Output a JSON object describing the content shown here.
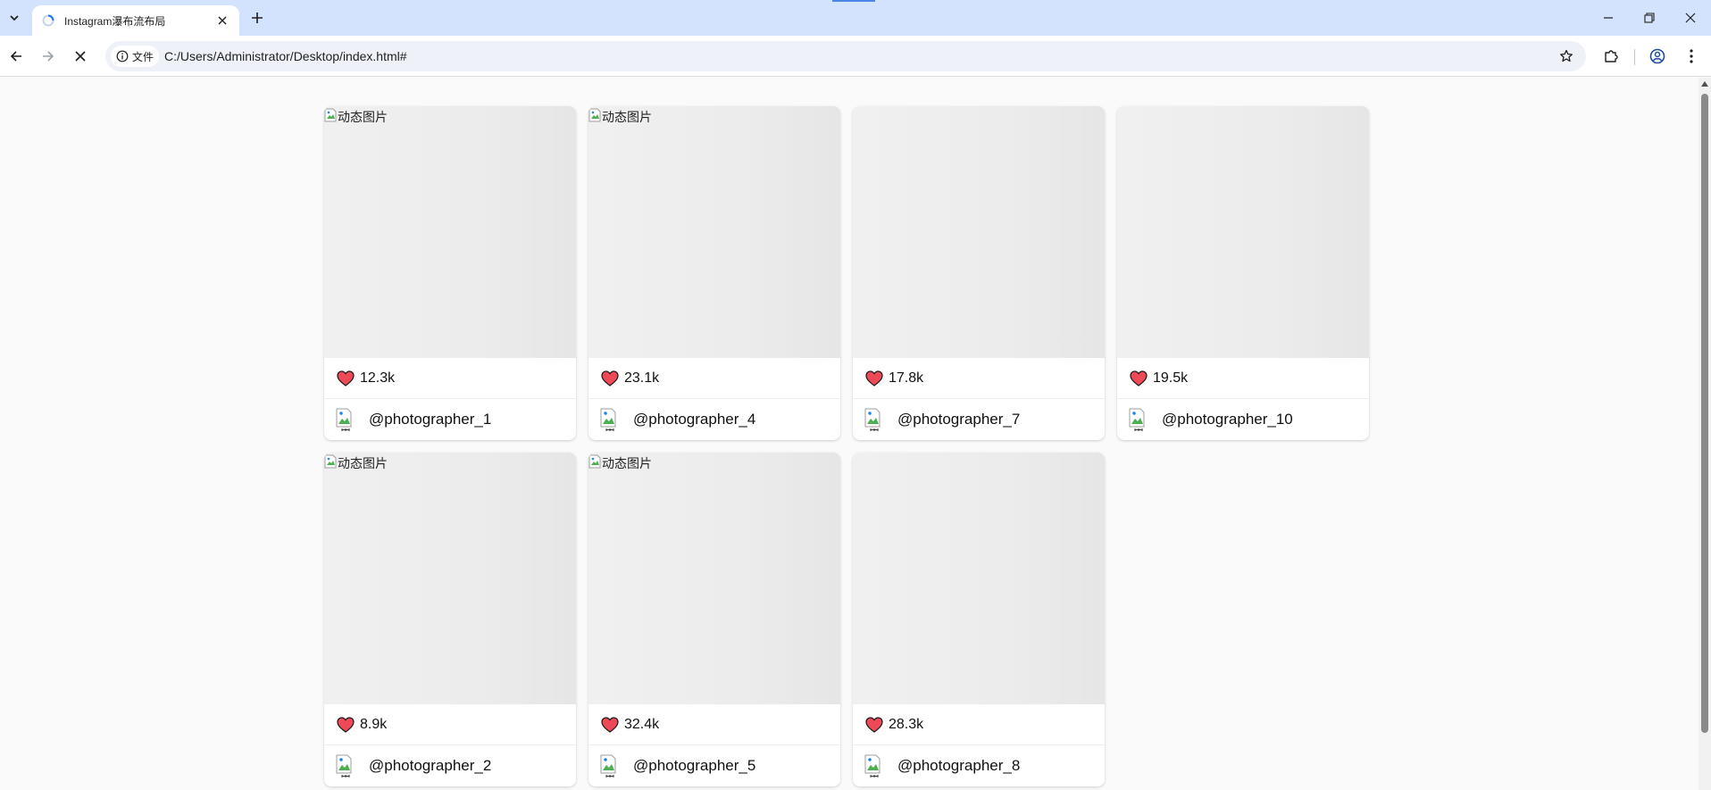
{
  "browser": {
    "tab_title": "Instagram瀑布流布局",
    "site_info_label": "文件",
    "url": "C:/Users/Administrator/Desktop/index.html#"
  },
  "page": {
    "broken_image_alt": "动态图片",
    "accent_color": "#ed4956",
    "posts": [
      {
        "likes": "12.3k",
        "user": "@photographer_1",
        "image_state": "broken"
      },
      {
        "likes": "23.1k",
        "user": "@photographer_4",
        "image_state": "broken"
      },
      {
        "likes": "17.8k",
        "user": "@photographer_7",
        "image_state": "loading"
      },
      {
        "likes": "19.5k",
        "user": "@photographer_10",
        "image_state": "loading"
      },
      {
        "likes": "8.9k",
        "user": "@photographer_2",
        "image_state": "broken"
      },
      {
        "likes": "32.4k",
        "user": "@photographer_5",
        "image_state": "broken"
      },
      {
        "likes": "28.3k",
        "user": "@photographer_8",
        "image_state": "loading"
      }
    ]
  }
}
